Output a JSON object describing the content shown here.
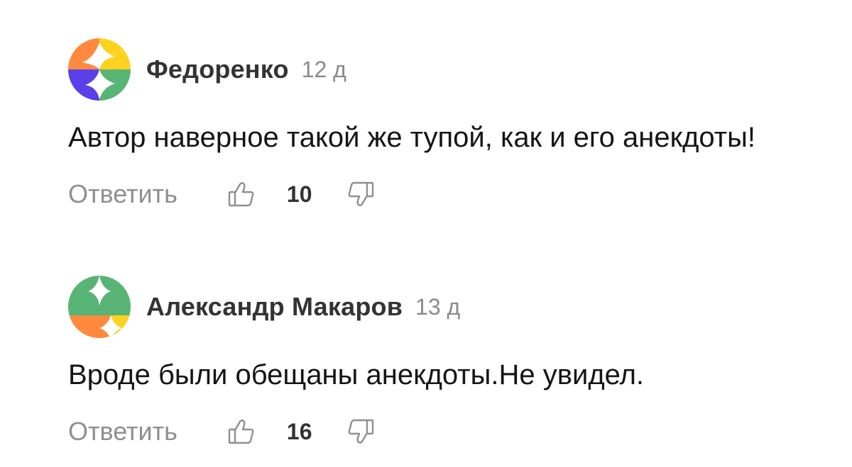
{
  "comments": [
    {
      "author": "Федоренко",
      "time": "12 д",
      "text": "Автор наверное такой же тупой, как и его анекдоты!",
      "reply_label": "Ответить",
      "likes": "10",
      "avatar_icon": "generated-avatar-icon",
      "avatar_colors": [
        "#ff8a3d",
        "#ffd21f",
        "#5b3fe8",
        "#58b474"
      ]
    },
    {
      "author": "Александр Макаров",
      "time": "13 д",
      "text": "Вроде были обещаны анекдоты.Не увидел.",
      "reply_label": "Ответить",
      "likes": "16",
      "avatar_icon": "generated-avatar-icon",
      "avatar_colors": [
        "#58b474",
        "#ff8a3d",
        "#ffd21f"
      ]
    }
  ],
  "icons": {
    "like": "thumbs-up-icon",
    "dislike": "thumbs-down-icon"
  },
  "colors": {
    "muted_text": "#8f8f8f",
    "author_text": "#333333",
    "body_text": "#151515"
  }
}
